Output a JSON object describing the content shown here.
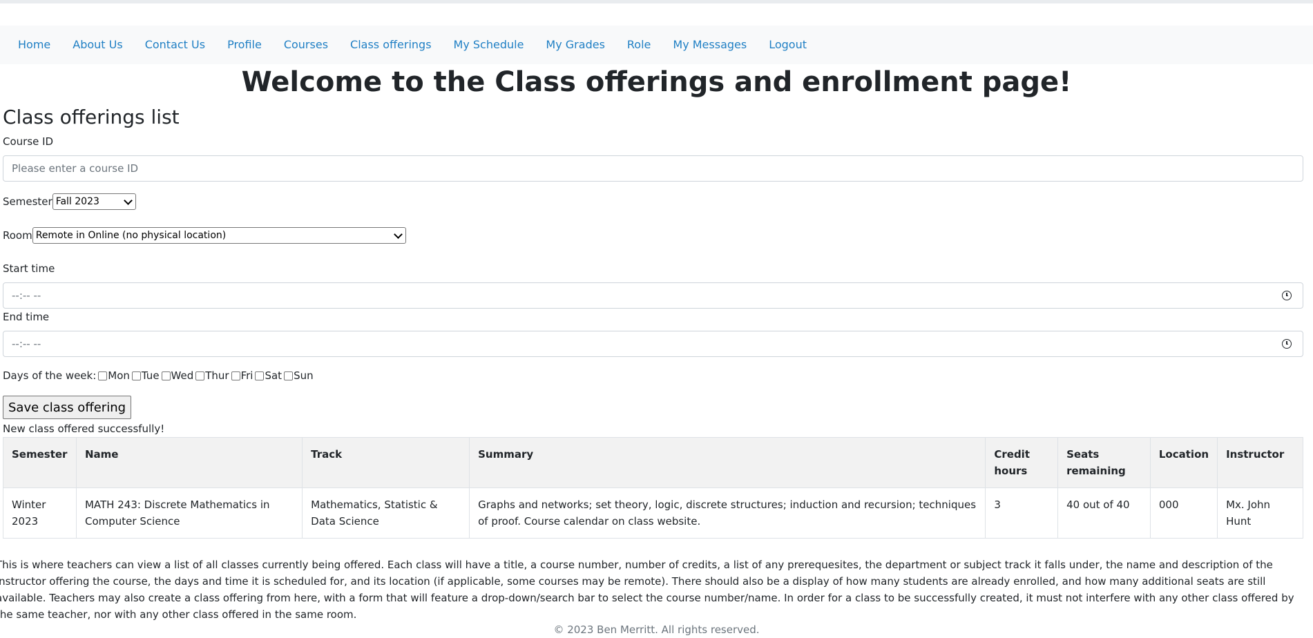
{
  "nav": {
    "items": [
      "Home",
      "About Us",
      "Contact Us",
      "Profile",
      "Courses",
      "Class offerings",
      "My Schedule",
      "My Grades",
      "Role",
      "My Messages",
      "Logout"
    ]
  },
  "page_title": "Welcome to the Class offerings and enrollment page!",
  "section_title": "Class offerings list",
  "form": {
    "course_id_label": "Course ID",
    "course_id_placeholder": "Please enter a course ID",
    "semester_label": "Semester",
    "semester_value": "Fall 2023",
    "room_label": "Room",
    "room_value": "Remote in Online (no physical location)",
    "start_time_label": "Start time",
    "start_time_value": "--:-- --",
    "end_time_label": "End time",
    "end_time_value": "--:-- --",
    "days_label": "Days of the week:",
    "days": [
      "Mon",
      "Tue",
      "Wed",
      "Thur",
      "Fri",
      "Sat",
      "Sun"
    ],
    "save_label": "Save class offering",
    "success_message": "New class offered successfully!"
  },
  "table": {
    "headers": [
      "Semester",
      "Name",
      "Track",
      "Summary",
      "Credit hours",
      "Seats remaining",
      "Location",
      "Instructor"
    ],
    "rows": [
      [
        "Winter 2023",
        "MATH 243: Discrete Mathematics in Computer Science",
        "Mathematics, Statistic & Data Science",
        "Graphs and networks; set theory, logic, discrete structures; induction and recursion; techniques of proof. Course calendar on class website.",
        "3",
        "40 out of 40",
        "000",
        "Mx. John Hunt"
      ]
    ]
  },
  "description": "This is where teachers can view a list of all classes currently being offered. Each class will have a title, a course number, number of credits, a list of any prerequesites, the department or subject track it falls under, the name and description of the instructor offering the course, the days and time it is scheduled for, and its location (if applicable, some courses may be remote). There should also be a display of how many students are already enrolled, and how many additional seats are still available. Teachers may also create a class offering from here, with a form that will feature a drop-down/search bar to select the course number/name. In order for a class to be successfully created, it must not interfere with any other class offered by the same teacher, nor with any other class offered in the same room.",
  "footer": "© 2023 Ben Merritt. All rights reserved."
}
